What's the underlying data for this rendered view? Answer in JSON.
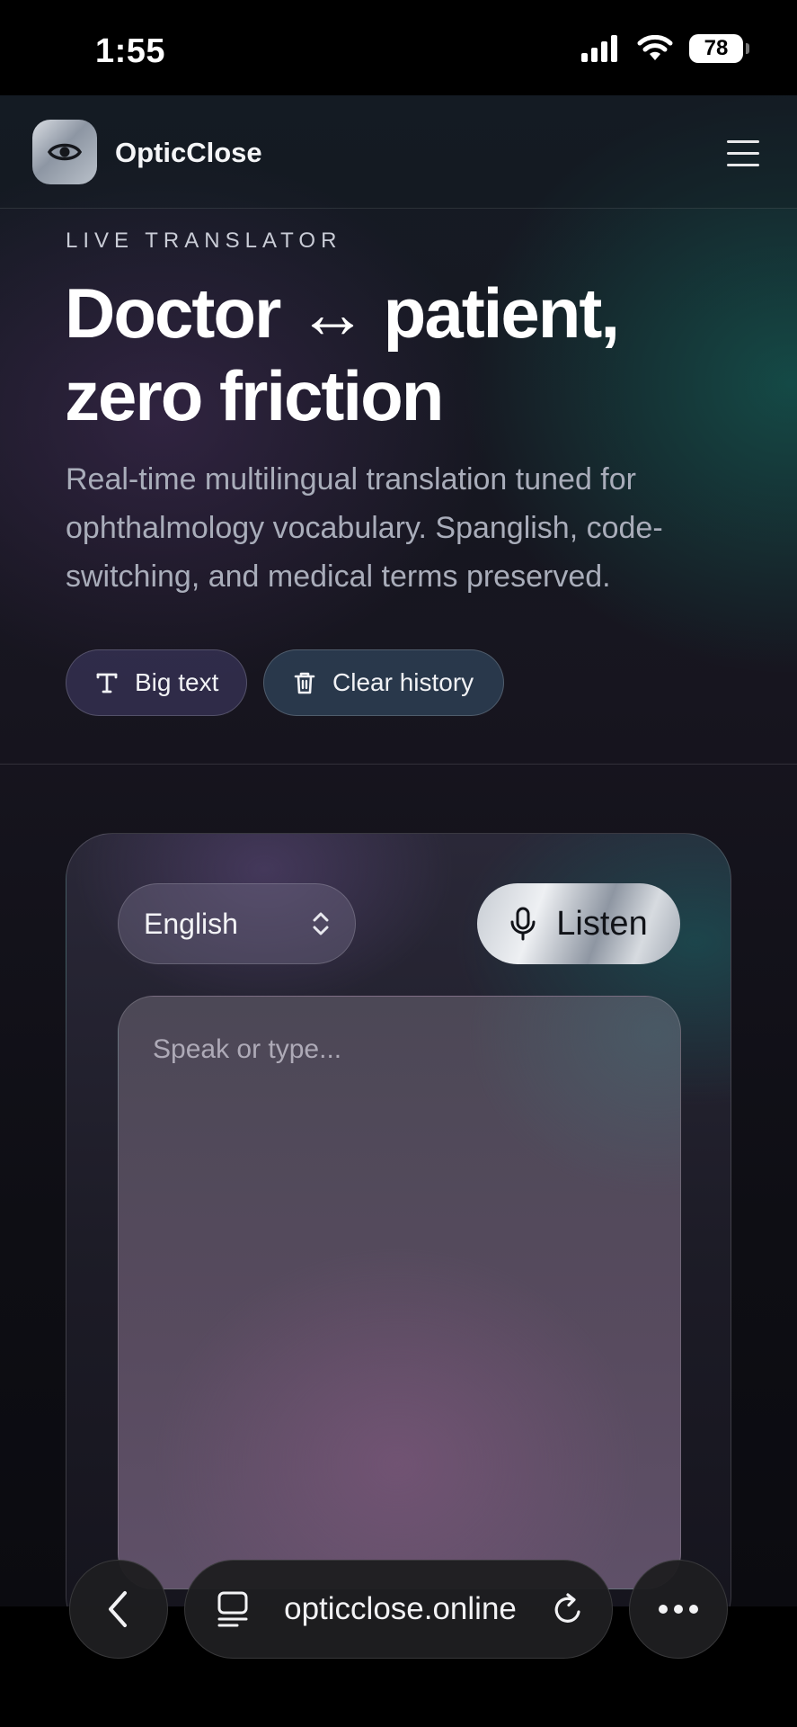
{
  "status_bar": {
    "time": "1:55",
    "battery": "78"
  },
  "header": {
    "brand": "OpticClose"
  },
  "hero": {
    "eyebrow": "LIVE TRANSLATOR",
    "title_line1": "Doctor ↔ patient,",
    "title_line2": "zero friction",
    "subtitle": "Real-time multilingual translation tuned for ophthalmology vocabulary. Spanglish, code-switching, and medical terms preserved."
  },
  "actions": {
    "big_text_label": "Big text",
    "clear_history_label": "Clear history"
  },
  "translator": {
    "language": "English",
    "listen_label": "Listen",
    "input_placeholder": "Speak or type..."
  },
  "browser": {
    "url": "opticclose.online"
  },
  "colors": {
    "accent_teal": "#145a52",
    "accent_purple": "#462d5a",
    "background": "#0b0b10"
  }
}
